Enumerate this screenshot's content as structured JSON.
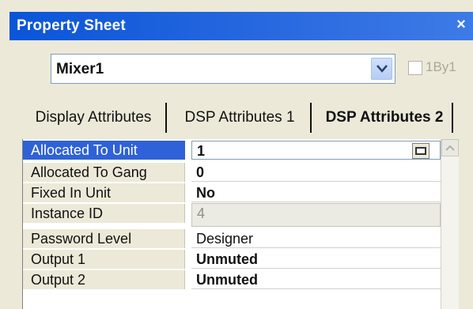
{
  "window": {
    "title": "Property Sheet",
    "close_label": "×"
  },
  "component_selector": {
    "value": "Mixer1"
  },
  "one_by_one": {
    "label": "1By1",
    "checked": false
  },
  "tabs": [
    {
      "label": "Display Attributes"
    },
    {
      "label": "DSP Attributes 1",
      "selected": true
    },
    {
      "label": "DSP Attributes 2"
    }
  ],
  "properties": [
    {
      "name": "Allocated To Unit",
      "value": "1"
    },
    {
      "name": "Allocated To Gang",
      "value": "0"
    },
    {
      "name": "Fixed In Unit",
      "value": "No"
    },
    {
      "name": "Instance ID",
      "value": "4"
    },
    {
      "name": "Password Level",
      "value": "Designer"
    },
    {
      "name": "Output 1",
      "value": "Unmuted"
    },
    {
      "name": "Output 2",
      "value": "Unmuted"
    }
  ],
  "colors": {
    "titlebar": "#0a55d8",
    "selection": "#2e62d6",
    "panel": "#ece9d8"
  }
}
